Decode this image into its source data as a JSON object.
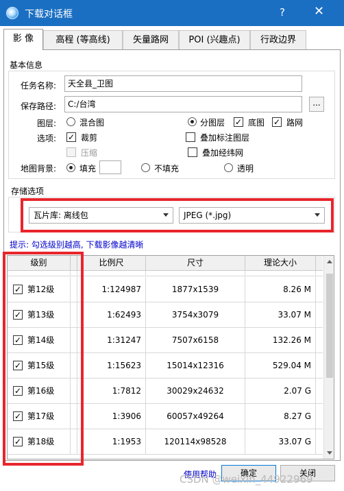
{
  "window": {
    "title": "下载对话框",
    "help": "?",
    "close": "✕"
  },
  "tabs": [
    {
      "label": "影 像"
    },
    {
      "label": "高程 (等高线)"
    },
    {
      "label": "矢量路网"
    },
    {
      "label": "POI (兴趣点)"
    },
    {
      "label": "行政边界"
    }
  ],
  "basic_info": {
    "section_title": "基本信息",
    "task_name_label": "任务名称:",
    "task_name_value": "天全县_卫图",
    "save_path_label": "保存路径:",
    "save_path_value": "C:/台湾",
    "browse_label": "...",
    "layer_label": "图层:",
    "layer_options": {
      "mixed": "混合图",
      "split": "分图层",
      "base": "底图",
      "road": "路网"
    },
    "options_label": "选项:",
    "option_items": {
      "crop": "裁剪",
      "add_label_layer": "叠加标注图层",
      "compress": "压缩",
      "add_grid": "叠加经纬网"
    },
    "bg_label": "地图背景:",
    "bg_options": {
      "fill": "填充",
      "no_fill": "不填充",
      "transparent": "透明"
    }
  },
  "storage": {
    "section_title": "存储选项",
    "format_select": "瓦片库: 离线包",
    "image_select": "JPEG (*.jpg)"
  },
  "hint": "提示: 勾选级别越高, 下载影像越清晰",
  "table": {
    "headers": {
      "level": "级别",
      "scale": "比例尺",
      "size": "尺寸",
      "theory": "理论大小"
    },
    "rows": [
      {
        "level": "第12级",
        "scale": "1:124987",
        "size": "1877x1539",
        "theory": "8.26 M"
      },
      {
        "level": "第13级",
        "scale": "1:62493",
        "size": "3754x3079",
        "theory": "33.07 M"
      },
      {
        "level": "第14级",
        "scale": "1:31247",
        "size": "7507x6158",
        "theory": "132.26 M"
      },
      {
        "level": "第15级",
        "scale": "1:15623",
        "size": "15014x12316",
        "theory": "529.04 M"
      },
      {
        "level": "第16级",
        "scale": "1:7812",
        "size": "30029x24632",
        "theory": "2.07 G"
      },
      {
        "level": "第17级",
        "scale": "1:3906",
        "size": "60057x49264",
        "theory": "8.27 G"
      },
      {
        "level": "第18级",
        "scale": "1:1953",
        "size": "120114x98528",
        "theory": "33.07 G"
      }
    ]
  },
  "footer": {
    "help_link": "使用帮助",
    "ok": "确定",
    "close": "关闭"
  },
  "watermark": "CSDN @weixin_44922969",
  "colors": {
    "titlebar": "#1b6fc2",
    "highlight_box": "#e8252c",
    "hint": "#0000cc"
  }
}
